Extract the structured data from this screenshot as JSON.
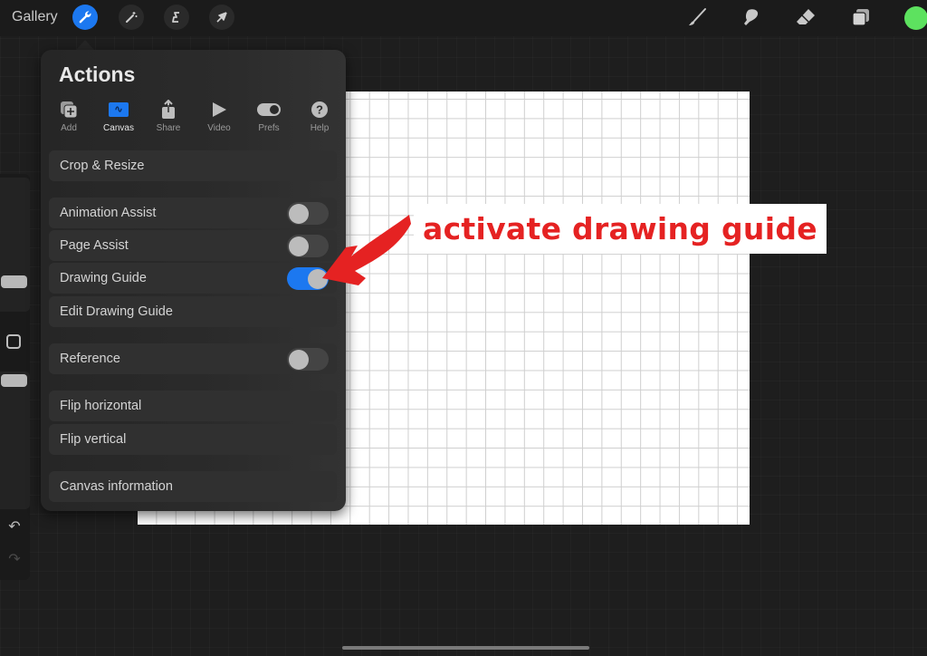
{
  "topbar": {
    "gallery_label": "Gallery",
    "left_tools": [
      {
        "name": "actions",
        "icon": "wrench-icon",
        "active": true
      },
      {
        "name": "adjustments",
        "icon": "magic-wand-icon",
        "active": false
      },
      {
        "name": "selection",
        "icon": "selection-s-icon",
        "active": false
      },
      {
        "name": "transform",
        "icon": "arrow-cursor-icon",
        "active": false
      }
    ],
    "right_tools": [
      {
        "name": "brush",
        "icon": "brush-icon"
      },
      {
        "name": "smudge",
        "icon": "smudge-icon"
      },
      {
        "name": "eraser",
        "icon": "eraser-icon"
      },
      {
        "name": "layers",
        "icon": "layers-icon"
      }
    ],
    "current_color": "#5de25f"
  },
  "accent_color": "#1c78f0",
  "actions_panel": {
    "title": "Actions",
    "tabs": [
      {
        "label": "Add",
        "icon": "add-icon",
        "active": false
      },
      {
        "label": "Canvas",
        "icon": "canvas-icon",
        "active": true
      },
      {
        "label": "Share",
        "icon": "share-icon",
        "active": false
      },
      {
        "label": "Video",
        "icon": "play-icon",
        "active": false
      },
      {
        "label": "Prefs",
        "icon": "toggle-icon",
        "active": false
      },
      {
        "label": "Help",
        "icon": "help-icon",
        "active": false
      }
    ],
    "items": {
      "crop_resize": "Crop & Resize",
      "animation_assist": {
        "label": "Animation Assist",
        "on": false
      },
      "page_assist": {
        "label": "Page Assist",
        "on": false
      },
      "drawing_guide": {
        "label": "Drawing Guide",
        "on": true
      },
      "edit_drawing_guide": "Edit Drawing Guide",
      "reference": {
        "label": "Reference",
        "on": false
      },
      "flip_horizontal": "Flip horizontal",
      "flip_vertical": "Flip vertical",
      "canvas_information": "Canvas information"
    }
  },
  "sidebar": {
    "undo_icon": "↶",
    "redo_icon": "↷"
  },
  "annotation": {
    "text": "activate drawing guide",
    "color": "#e52222"
  }
}
